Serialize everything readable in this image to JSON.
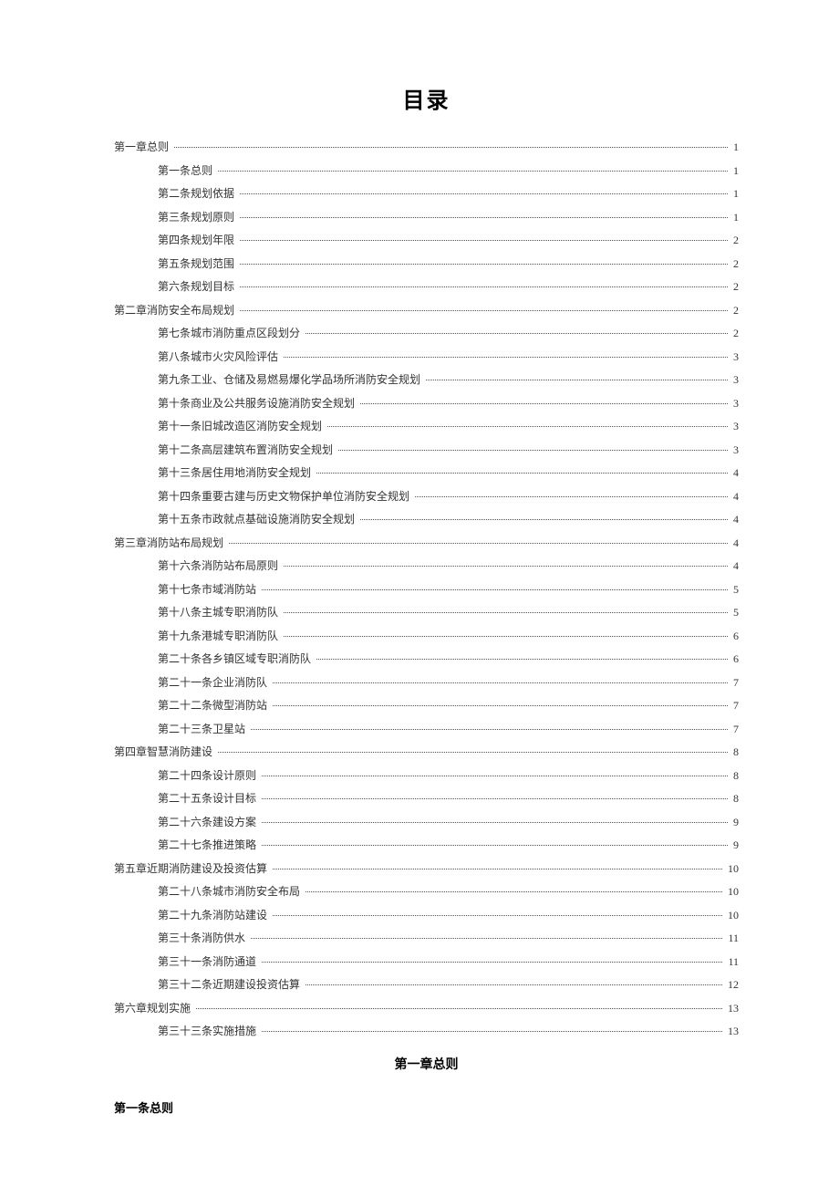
{
  "title": "目录",
  "toc": [
    {
      "level": 1,
      "label": "第一章总则",
      "page": "1"
    },
    {
      "level": 2,
      "label": "第一条总则",
      "page": "1"
    },
    {
      "level": 2,
      "label": "第二条规划依据",
      "page": "1"
    },
    {
      "level": 2,
      "label": "第三条规划原则",
      "page": "1"
    },
    {
      "level": 2,
      "label": "第四条规划年限",
      "page": "2"
    },
    {
      "level": 2,
      "label": "第五条规划范围",
      "page": "2"
    },
    {
      "level": 2,
      "label": "第六条规划目标",
      "page": "2"
    },
    {
      "level": 1,
      "label": "第二章消防安全布局规划",
      "page": "2"
    },
    {
      "level": 2,
      "label": "第七条城市消防重点区段划分",
      "page": "2"
    },
    {
      "level": 2,
      "label": "第八条城市火灾风险评估",
      "page": "3"
    },
    {
      "level": 2,
      "label": "第九条工业、仓储及易燃易爆化学品场所消防安全规划",
      "page": "3"
    },
    {
      "level": 2,
      "label": "第十条商业及公共服务设施消防安全规划",
      "page": "3"
    },
    {
      "level": 2,
      "label": "第十一条旧城改造区消防安全规划",
      "page": "3"
    },
    {
      "level": 2,
      "label": "第十二条高层建筑布置消防安全规划",
      "page": "3"
    },
    {
      "level": 2,
      "label": "第十三条居住用地消防安全规划",
      "page": "4"
    },
    {
      "level": 2,
      "label": "第十四条重要古建与历史文物保护单位消防安全规划",
      "page": "4"
    },
    {
      "level": 2,
      "label": "第十五条市政就点基础设施消防安全规划",
      "page": "4"
    },
    {
      "level": 1,
      "label": "第三章消防站布局规划",
      "page": "4"
    },
    {
      "level": 2,
      "label": "第十六条消防站布局原则",
      "page": "4"
    },
    {
      "level": 2,
      "label": "第十七条市域消防站",
      "page": "5"
    },
    {
      "level": 2,
      "label": "第十八条主城专职消防队",
      "page": "5"
    },
    {
      "level": 2,
      "label": "第十九条港城专职消防队",
      "page": "6"
    },
    {
      "level": 2,
      "label": "第二十条各乡镇区域专职消防队",
      "page": "6"
    },
    {
      "level": 2,
      "label": "第二十一条企业消防队",
      "page": "7"
    },
    {
      "level": 2,
      "label": "第二十二条微型消防站",
      "page": "7"
    },
    {
      "level": 2,
      "label": "第二十三条卫星站",
      "page": "7"
    },
    {
      "level": 1,
      "label": "第四章智慧消防建设",
      "page": "8"
    },
    {
      "level": 2,
      "label": "第二十四条设计原则",
      "page": "8"
    },
    {
      "level": 2,
      "label": "第二十五条设计目标",
      "page": "8"
    },
    {
      "level": 2,
      "label": "第二十六条建设方案",
      "page": "9"
    },
    {
      "level": 2,
      "label": "第二十七条推进策略",
      "page": "9"
    },
    {
      "level": 1,
      "label": "第五章近期消防建设及投资估算",
      "page": "10"
    },
    {
      "level": 2,
      "label": "第二十八条城市消防安全布局",
      "page": "10"
    },
    {
      "level": 2,
      "label": "第二十九条消防站建设",
      "page": "10"
    },
    {
      "level": 2,
      "label": "第三十条消防供水",
      "page": "11"
    },
    {
      "level": 2,
      "label": "第三十一条消防通道",
      "page": "11"
    },
    {
      "level": 2,
      "label": "第三十二条近期建设投资估算",
      "page": "12"
    },
    {
      "level": 1,
      "label": "第六章规划实施",
      "page": "13"
    },
    {
      "level": 2,
      "label": "第三十三条实施措施",
      "page": "13"
    }
  ],
  "chapter_heading": "第一章总则",
  "section_heading": "第一条总则"
}
